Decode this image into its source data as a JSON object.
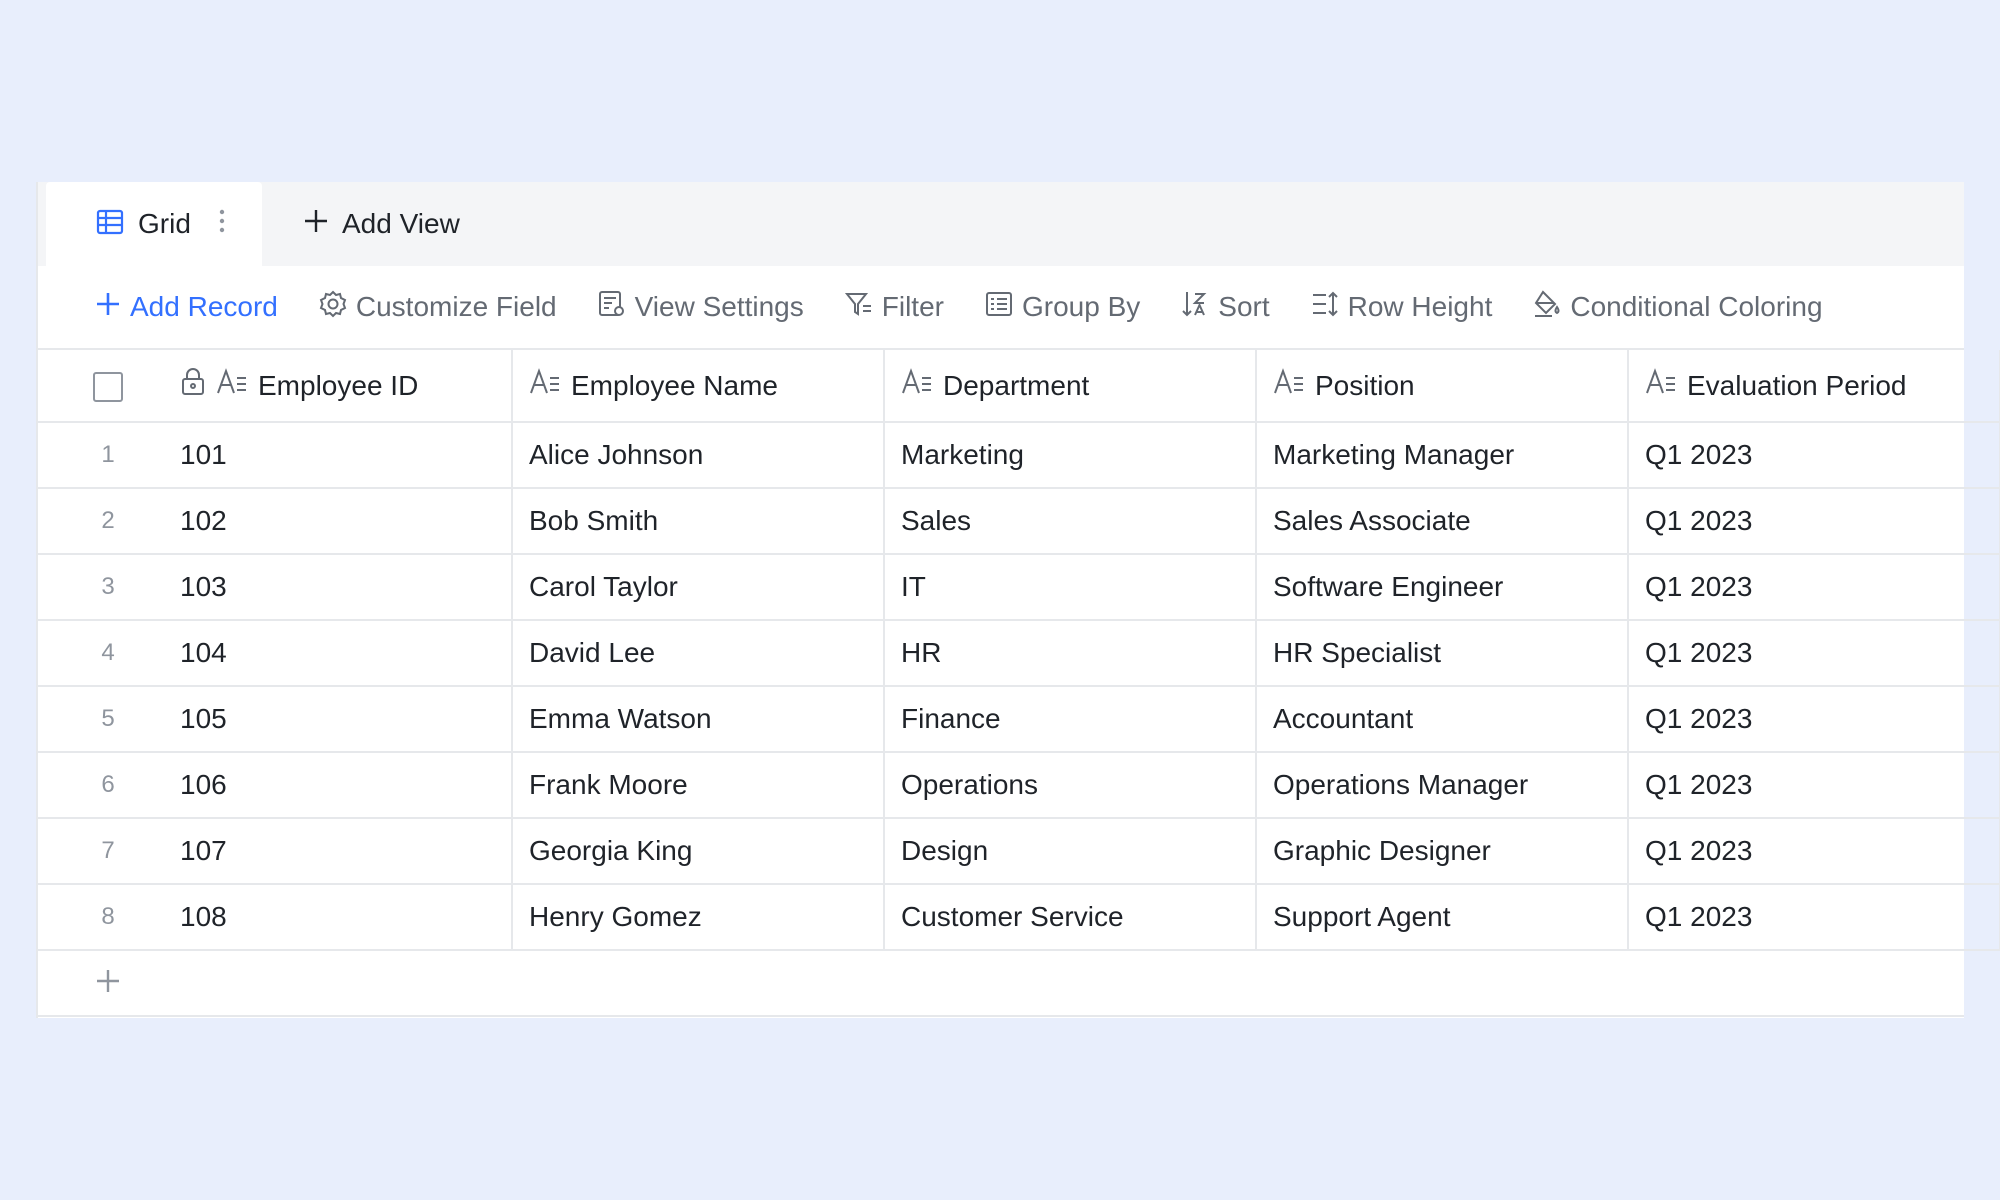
{
  "tabs": {
    "active_label": "Grid",
    "add_view_label": "Add View"
  },
  "toolbar": {
    "add_record": "Add Record",
    "customize_field": "Customize Field",
    "view_settings": "View Settings",
    "filter": "Filter",
    "group_by": "Group By",
    "sort": "Sort",
    "row_height": "Row Height",
    "conditional_coloring": "Conditional Coloring"
  },
  "table": {
    "columns": [
      "Employee ID",
      "Employee Name",
      "Department",
      "Position",
      "Evaluation Period"
    ],
    "rows": [
      {
        "num": "1",
        "id": "101",
        "name": "Alice Johnson",
        "dept": "Marketing",
        "pos": "Marketing Manager",
        "eval": "Q1 2023"
      },
      {
        "num": "2",
        "id": "102",
        "name": "Bob Smith",
        "dept": "Sales",
        "pos": "Sales Associate",
        "eval": "Q1 2023"
      },
      {
        "num": "3",
        "id": "103",
        "name": "Carol Taylor",
        "dept": "IT",
        "pos": "Software Engineer",
        "eval": "Q1 2023"
      },
      {
        "num": "4",
        "id": "104",
        "name": "David Lee",
        "dept": "HR",
        "pos": "HR Specialist",
        "eval": "Q1 2023"
      },
      {
        "num": "5",
        "id": "105",
        "name": "Emma Watson",
        "dept": "Finance",
        "pos": "Accountant",
        "eval": "Q1 2023"
      },
      {
        "num": "6",
        "id": "106",
        "name": "Frank Moore",
        "dept": "Operations",
        "pos": "Operations Manager",
        "eval": "Q1 2023"
      },
      {
        "num": "7",
        "id": "107",
        "name": "Georgia King",
        "dept": "Design",
        "pos": "Graphic Designer",
        "eval": "Q1 2023"
      },
      {
        "num": "8",
        "id": "108",
        "name": "Henry Gomez",
        "dept": "Customer Service",
        "pos": "Support Agent",
        "eval": "Q1 2023"
      }
    ]
  },
  "colors": {
    "accent": "#3370ff",
    "background": "#e8eefc",
    "muted_text": "#646a73",
    "border": "#e6e8eb"
  },
  "icons": {
    "grid_tab": "grid-icon",
    "add": "plus-icon",
    "customize": "gear-icon",
    "view_settings": "view-settings-icon",
    "filter": "filter-icon",
    "group_by": "group-list-icon",
    "sort": "sort-az-icon",
    "row_height": "row-height-icon",
    "conditional_coloring": "paint-bucket-icon",
    "lock": "lock-icon",
    "text_field": "text-field-icon"
  }
}
